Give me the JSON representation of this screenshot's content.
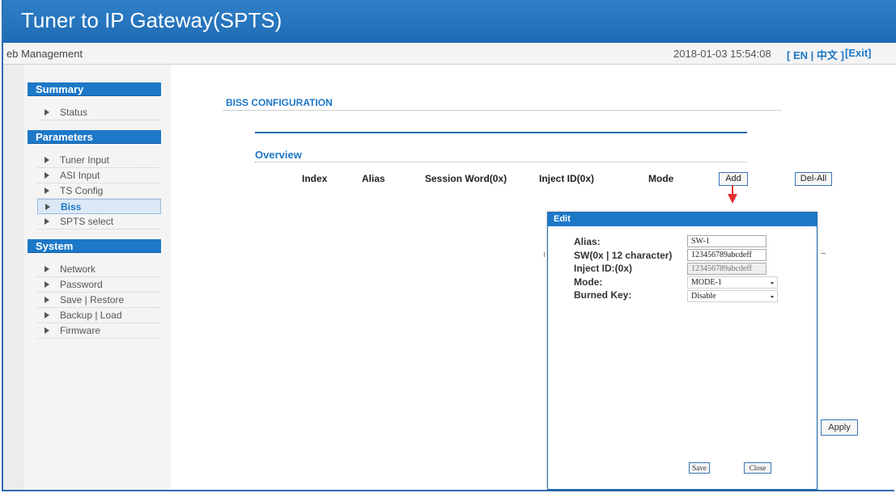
{
  "app": {
    "title": "Tuner to IP Gateway(SPTS)"
  },
  "menubar": {
    "management": "eb Management",
    "datetime": "2018-01-03 15:54:08",
    "lang_open": "[",
    "lang_en": "EN",
    "lang_sep": "|",
    "lang_cn": "中文",
    "lang_close": "]",
    "exit": "[Exit]"
  },
  "sidebar": {
    "summary": {
      "header": "Summary",
      "items": [
        "Status"
      ]
    },
    "parameters": {
      "header": "Parameters",
      "items": [
        "Tuner Input",
        "ASI Input",
        "TS Config",
        "Biss",
        "SPTS select"
      ],
      "active": "Biss"
    },
    "system": {
      "header": "System",
      "items": [
        "Network",
        "Password",
        "Save | Restore",
        "Backup | Load",
        "Firmware"
      ]
    }
  },
  "main": {
    "page_title": "BISS CONFIGURATION",
    "overview": "Overview",
    "columns": [
      "Index",
      "Alias",
      "Session Word(0x)",
      "Inject ID(0x)",
      "Mode"
    ],
    "add_label": "Add",
    "del_all_label": "Del-All",
    "apply_label": "Apply"
  },
  "dialog": {
    "title": "Edit",
    "alias_label": "Alias:",
    "alias_value": "SW-1",
    "sw_label": "SW(0x | 12 character)",
    "sw_value": "123456789abcdeff",
    "inject_label": "Inject ID:(0x)",
    "inject_value": "123456789abcdeff",
    "mode_label": "Mode:",
    "mode_value": "MODE-1",
    "burned_label": "Burned Key:",
    "burned_value": "Disable",
    "save_label": "Save",
    "close_label": "Close"
  },
  "colors": {
    "accent": "#1d78c8",
    "titlebar": "#1f6bb4",
    "arrow": "#e53030"
  }
}
